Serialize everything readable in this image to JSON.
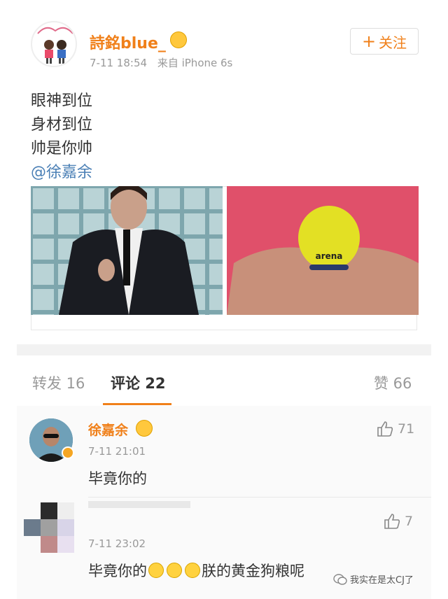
{
  "post": {
    "username": "詩銘blue_",
    "timestamp": "7-11 18:54",
    "source": "来自 iPhone 6s",
    "follow_label": "关注",
    "lines": [
      "眼神到位",
      "身材到位",
      "帅是你帅"
    ],
    "mention": "@徐嘉余",
    "image_cap_brand": "arena"
  },
  "tabs": {
    "repost": "转发 16",
    "comments": "评论 22",
    "likes": "赞 66"
  },
  "comments": [
    {
      "name": "徐嘉余",
      "time": "7-11 21:01",
      "text": "毕竟你的",
      "likes": "71"
    },
    {
      "name": "",
      "time": "7-11 23:02",
      "text_prefix": "毕竟你的",
      "text_suffix": "朕的黄金狗粮呢",
      "likes": "7"
    }
  ],
  "watermark": "我实在是太CJ了",
  "colors": {
    "accent": "#f0801a",
    "link": "#4a7fb5"
  }
}
